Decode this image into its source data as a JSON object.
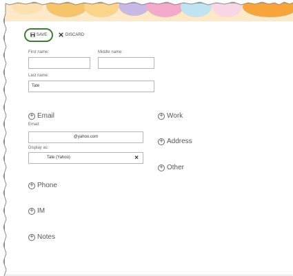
{
  "toolbar": {
    "save_label": "SAVE",
    "discard_label": "DISCARD"
  },
  "name": {
    "first_label": "First name:",
    "first_value": "",
    "middle_label": "Middle name:",
    "middle_value": "",
    "last_label": "Last name:",
    "last_value": "Tate"
  },
  "email": {
    "section_label": "Email",
    "email_label": "Email:",
    "email_value": "@yahoo.com",
    "display_label": "Display as:",
    "display_value": "Tate (Yahoo)"
  },
  "sections": {
    "work": "Work",
    "address": "Address",
    "other": "Other",
    "phone": "Phone",
    "im": "IM",
    "notes": "Notes"
  },
  "colors": {
    "save_outline": "#3a7f2c"
  }
}
